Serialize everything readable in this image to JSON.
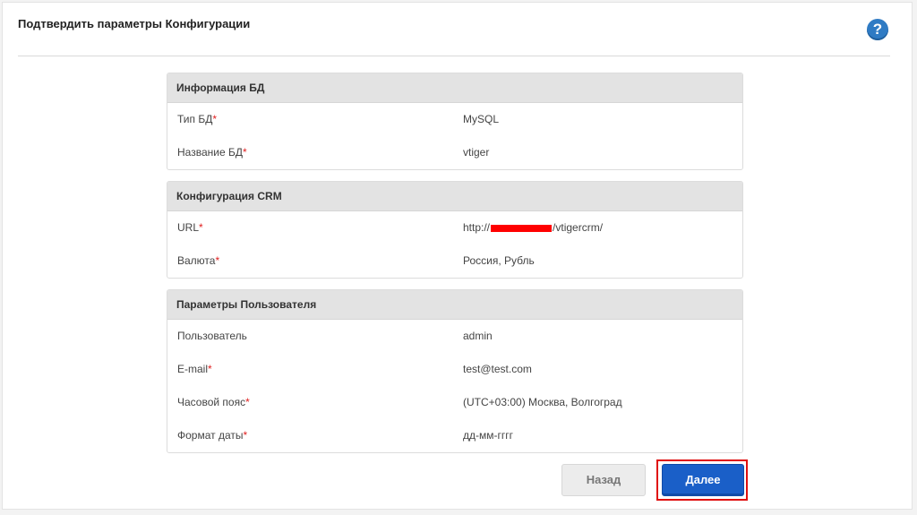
{
  "header": {
    "title": "Подтвердить параметры Конфигурации",
    "help_icon": "?"
  },
  "db_info": {
    "title": "Информация БД",
    "rows": [
      {
        "label": "Тип БД",
        "required": "*",
        "value": "MySQL"
      },
      {
        "label": "Название БД",
        "required": "*",
        "value": "vtiger"
      }
    ]
  },
  "crm_config": {
    "title": "Конфигурация CRM",
    "rows": [
      {
        "label": "URL",
        "required": "*",
        "value_prefix": "http://",
        "value_suffix": "/vtigercrm/"
      },
      {
        "label": "Валюта",
        "required": "*",
        "value": "Россия, Рубль"
      }
    ]
  },
  "user_params": {
    "title": "Параметры Пользователя",
    "rows": [
      {
        "label": "Пользователь",
        "required": "",
        "value": "admin"
      },
      {
        "label": "E-mail",
        "required": "*",
        "value": "test@test.com"
      },
      {
        "label": "Часовой пояс",
        "required": "*",
        "value": "(UTC+03:00) Москва, Волгоград"
      },
      {
        "label": "Формат даты",
        "required": "*",
        "value": "дд-мм-гггг"
      }
    ]
  },
  "buttons": {
    "back": "Назад",
    "next": "Далее"
  },
  "colors": {
    "primary": "#1a5fc8",
    "required": "#e02020",
    "link": "#2a6db0",
    "highlight": "#e01010"
  }
}
